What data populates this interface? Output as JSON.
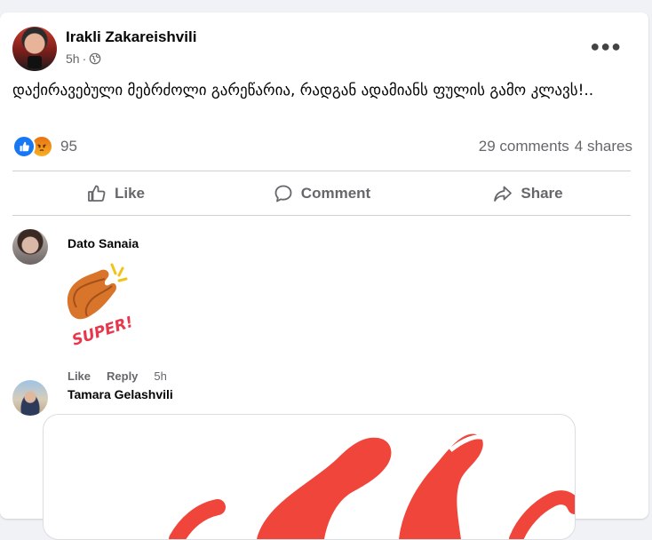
{
  "post": {
    "author": "Irakli Zakareishvili",
    "time": "5h",
    "meta_sep": "·",
    "text": "დაქირავებული მებრძოლი გარეწარია, რადგან ადამიანს ფულის გამო კლავს!..",
    "reactions": {
      "types": [
        "like-icon",
        "angry-icon"
      ],
      "count": "95"
    },
    "comments_count": "29 comments",
    "shares_count": "4 shares"
  },
  "actions": {
    "like": "Like",
    "comment": "Comment",
    "share": "Share"
  },
  "comments": [
    {
      "name": "Dato Sanaia",
      "sticker_text": "SUPER!",
      "like": "Like",
      "reply": "Reply",
      "time": "5h"
    },
    {
      "name": "Tamara Gelashvili"
    }
  ],
  "colors": {
    "accent": "#1877f2",
    "text_secondary": "#65676b",
    "divider": "#ced0d4",
    "sticker_red": "#e8364a",
    "image_red": "#f0453a"
  }
}
